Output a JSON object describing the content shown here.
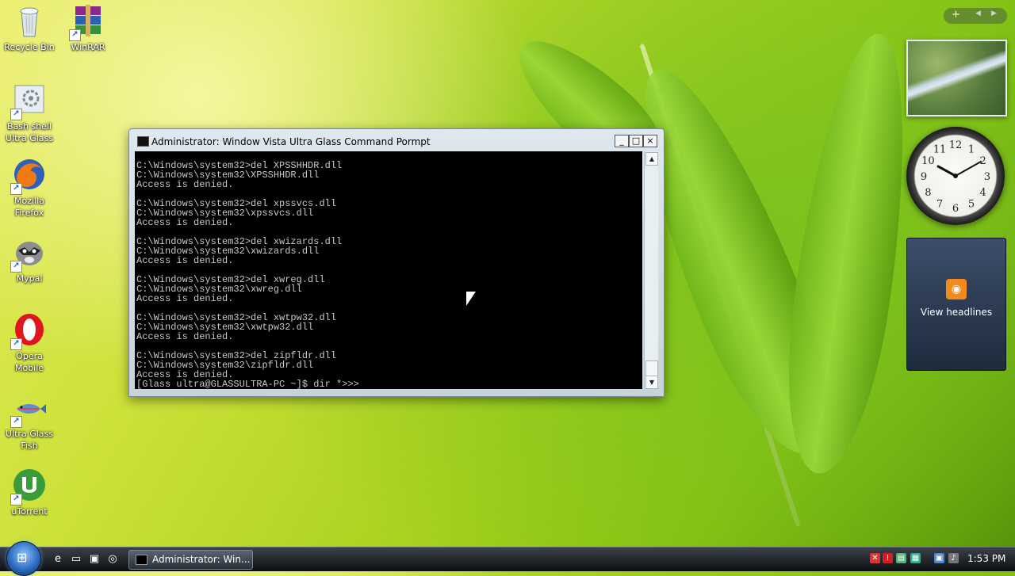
{
  "desktop": {
    "icons": [
      {
        "label_1": "Recycle Bin",
        "label_2": "",
        "icon": "recycle-bin-icon"
      },
      {
        "label_1": "WinRAR",
        "label_2": "",
        "icon": "winrar-icon"
      },
      {
        "label_1": "Bash shell",
        "label_2": "Ultra Glass",
        "icon": "bash-shell-icon"
      },
      {
        "label_1": "Mozilla",
        "label_2": "Firefox",
        "icon": "firefox-icon"
      },
      {
        "label_1": "Mypal",
        "label_2": "",
        "icon": "mypal-icon"
      },
      {
        "label_1": "Opera",
        "label_2": "Mobile",
        "icon": "opera-icon"
      },
      {
        "label_1": "Ultra Glass",
        "label_2": "Fish",
        "icon": "fish-icon"
      },
      {
        "label_1": "uTorrent",
        "label_2": "",
        "icon": "utorrent-icon"
      }
    ]
  },
  "window": {
    "title": "Administrator:  Window Vista Ultra Glass Command Pormpt",
    "minimize": "_",
    "maximize": "□",
    "close": "×",
    "console_text": "C:\\Windows\\system32>del XPSSHHDR.dll\nC:\\Windows\\system32\\XPSSHHDR.dll\nAccess is denied.\n\nC:\\Windows\\system32>del xpssvcs.dll\nC:\\Windows\\system32\\xpssvcs.dll\nAccess is denied.\n\nC:\\Windows\\system32>del xwizards.dll\nC:\\Windows\\system32\\xwizards.dll\nAccess is denied.\n\nC:\\Windows\\system32>del xwreg.dll\nC:\\Windows\\system32\\xwreg.dll\nAccess is denied.\n\nC:\\Windows\\system32>del xwtpw32.dll\nC:\\Windows\\system32\\xwtpw32.dll\nAccess is denied.\n\nC:\\Windows\\system32>del zipfldr.dll\nC:\\Windows\\system32\\zipfldr.dll\nAccess is denied.\n[Glass ultra@GLASSULTRA-PC ~]$ dir *>>>"
  },
  "gadgets": {
    "sidebar_add": "+",
    "feed_label": "View headlines",
    "clock_numbers": [
      "12",
      "1",
      "2",
      "3",
      "4",
      "5",
      "6",
      "7",
      "8",
      "9",
      "10",
      "11"
    ]
  },
  "taskbar": {
    "task_label": "Administrator:  Win...",
    "time": "1:53 PM"
  },
  "colors": {
    "console_bg": "#000000",
    "console_fg": "#c8c8c8",
    "desktop_green": "#9ad839"
  }
}
